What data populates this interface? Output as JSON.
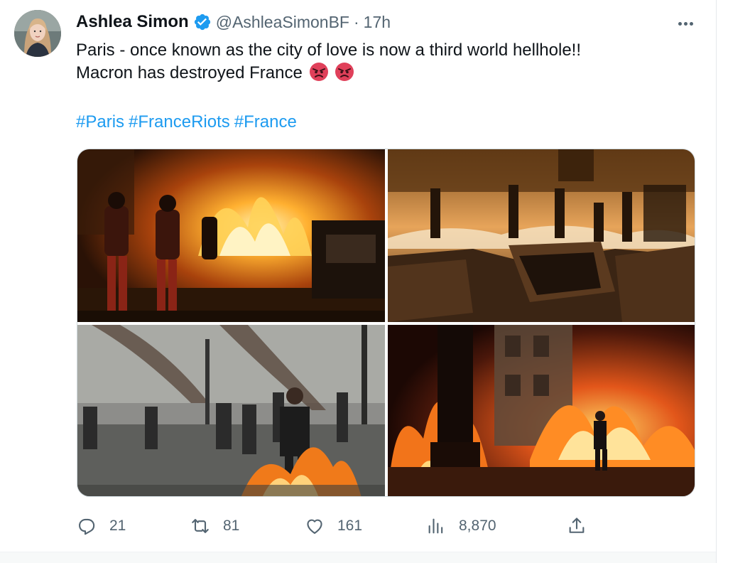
{
  "tweet": {
    "author": {
      "display_name": "Ashlea Simon",
      "verified": true,
      "handle": "@AshleaSimonBF",
      "separator": "·",
      "time": "17h"
    },
    "text_lines": [
      "Paris - once known as the city of love is now a third world hellhole!!",
      "Macron has destroyed France"
    ],
    "emojis": [
      "angry-face-icon",
      "angry-face-icon"
    ],
    "hashtags": [
      "#Paris",
      "#FranceRiots",
      "#France"
    ],
    "media": [
      {
        "icon": "photo-firefighters-burning-car"
      },
      {
        "icon": "photo-burned-vehicles-street"
      },
      {
        "icon": "photo-eiffel-tower-protesters-fire"
      },
      {
        "icon": "photo-man-running-from-flames"
      }
    ],
    "actions": {
      "replies": "21",
      "retweets": "81",
      "likes": "161",
      "views": "8,870"
    },
    "colors": {
      "accent": "#1d9bf0",
      "text": "#0f1419",
      "secondary": "#536471",
      "border": "#cfd9de"
    }
  }
}
